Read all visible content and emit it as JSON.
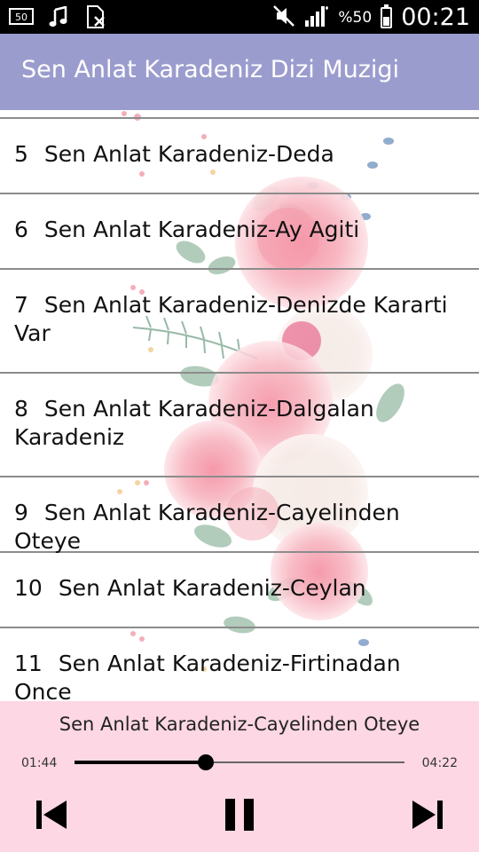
{
  "status_bar": {
    "battery_percent": "%50",
    "time": "00:21",
    "left_icons": [
      "lte-icon",
      "music-note-icon",
      "blocked-sim-icon"
    ],
    "right_icons": [
      "muted-icon",
      "signal-icon",
      "battery-icon"
    ]
  },
  "app_bar": {
    "title": "Sen Anlat Karadeniz Dizi Muzigi"
  },
  "tracks": [
    {
      "number": "5",
      "title": "Sen Anlat Karadeniz-Deda"
    },
    {
      "number": "6",
      "title": "Sen Anlat Karadeniz-Ay Agiti"
    },
    {
      "number": "7",
      "title": "Sen Anlat Karadeniz-Denizde Kararti Var"
    },
    {
      "number": "8",
      "title": "Sen Anlat Karadeniz-Dalgalan Karadeniz"
    },
    {
      "number": "9",
      "title": "Sen Anlat Karadeniz-Cayelinden Oteye"
    },
    {
      "number": "10",
      "title": "Sen Anlat Karadeniz-Ceylan"
    },
    {
      "number": "11",
      "title": "Sen Anlat Karadeniz-Firtinadan Once"
    }
  ],
  "player": {
    "now_playing": "Sen Anlat Karadeniz-Cayelinden Oteye",
    "current_time": "01:44",
    "total_time": "04:22",
    "progress_fraction": 0.397,
    "controls": [
      "previous-icon",
      "pause-icon",
      "next-icon"
    ]
  },
  "colors": {
    "app_bar": "#9b9cce",
    "player_bg": "#fdd7e4",
    "status_bar": "#000000"
  }
}
